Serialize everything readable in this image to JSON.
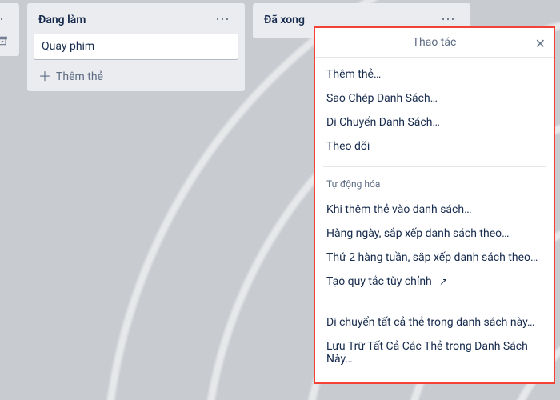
{
  "lists": {
    "partial": {},
    "doing": {
      "title": "Đang làm",
      "card0": "Quay phim",
      "add_card": "Thêm thẻ"
    },
    "done": {
      "title": "Đã xong"
    }
  },
  "popup": {
    "title": "Thao tác",
    "items": {
      "add_card": "Thêm thẻ…",
      "copy_list": "Sao Chép Danh Sách…",
      "move_list": "Di Chuyển Danh Sách…",
      "watch": "Theo dõi"
    },
    "automation_title": "Tự động hóa",
    "automation": {
      "when_add": "Khi thêm thẻ vào danh sách…",
      "daily": "Hàng ngày, sắp xếp danh sách theo…",
      "weekly_mon": "Thứ 2 hàng tuần, sắp xếp danh sách theo…",
      "custom_rule": "Tạo quy tắc tùy chỉnh"
    },
    "footer": {
      "move_all": "Di chuyển tất cả thẻ trong danh sách này…",
      "archive_all": "Lưu Trữ Tất Cả Các Thẻ trong Danh Sách Này…"
    }
  }
}
